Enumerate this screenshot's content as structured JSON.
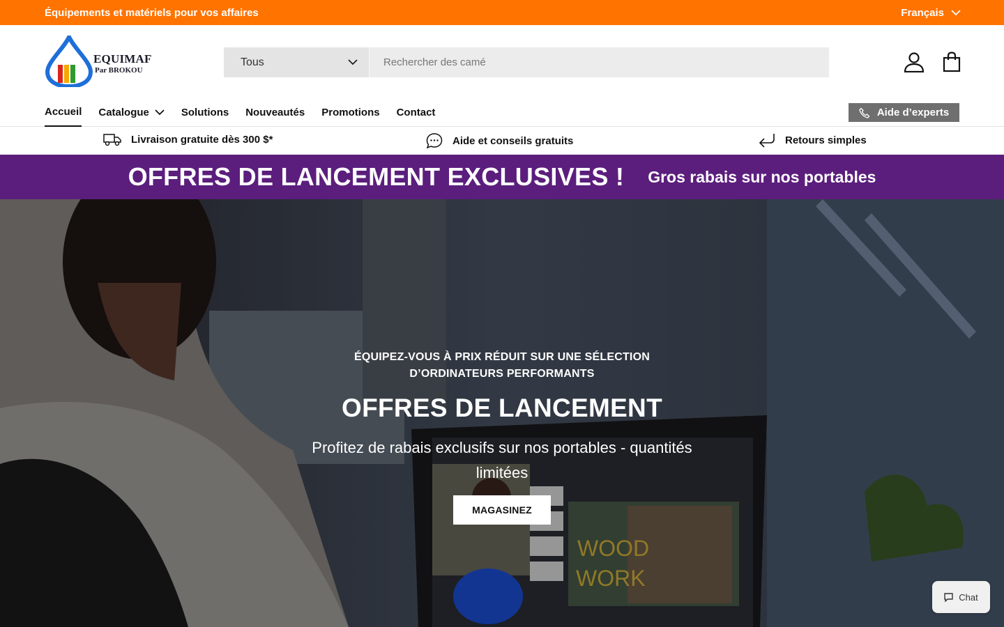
{
  "topbar": {
    "tagline": "Équipements et matériels pour vos affaires",
    "language": "Français"
  },
  "header": {
    "logo_brand": "EQUIMAF",
    "logo_sub": "Par BROKOU",
    "search_category": "Tous",
    "search_placeholder": "Rechercher des camé"
  },
  "nav": {
    "items": [
      {
        "label": "Accueil"
      },
      {
        "label": "Catalogue"
      },
      {
        "label": "Solutions"
      },
      {
        "label": "Nouveautés"
      },
      {
        "label": "Promotions"
      },
      {
        "label": "Contact"
      }
    ],
    "expert_label": "Aide d’experts"
  },
  "perks": [
    {
      "label": "Livraison gratuite dès 300 $*",
      "icon": "truck-icon"
    },
    {
      "label": "Aide et conseils gratuits",
      "icon": "chat-bubble-icon"
    },
    {
      "label": "Retours simples",
      "icon": "return-arrow-icon"
    }
  ],
  "promo": {
    "headline": "OFFRES DE LANCEMENT EXCLUSIVES !",
    "subline": "Gros rabais sur nos portables"
  },
  "hero": {
    "eyebrow": "ÉQUIPEZ-VOUS À PRIX RÉDUIT SUR UNE SÉLECTION D’ORDINATEURS PERFORMANTS",
    "title": "OFFRES DE LANCEMENT",
    "description": "Profitez de rabais exclusifs sur nos portables - quantités limitées",
    "cta": "MAGASINEZ",
    "screen_text_1": "WOOD",
    "screen_text_2": "WORK"
  },
  "chat": {
    "label": "Chat"
  },
  "colors": {
    "topbar": "#ff7300",
    "promo": "#5b1e7d",
    "expert_button": "#6f6f6f"
  }
}
